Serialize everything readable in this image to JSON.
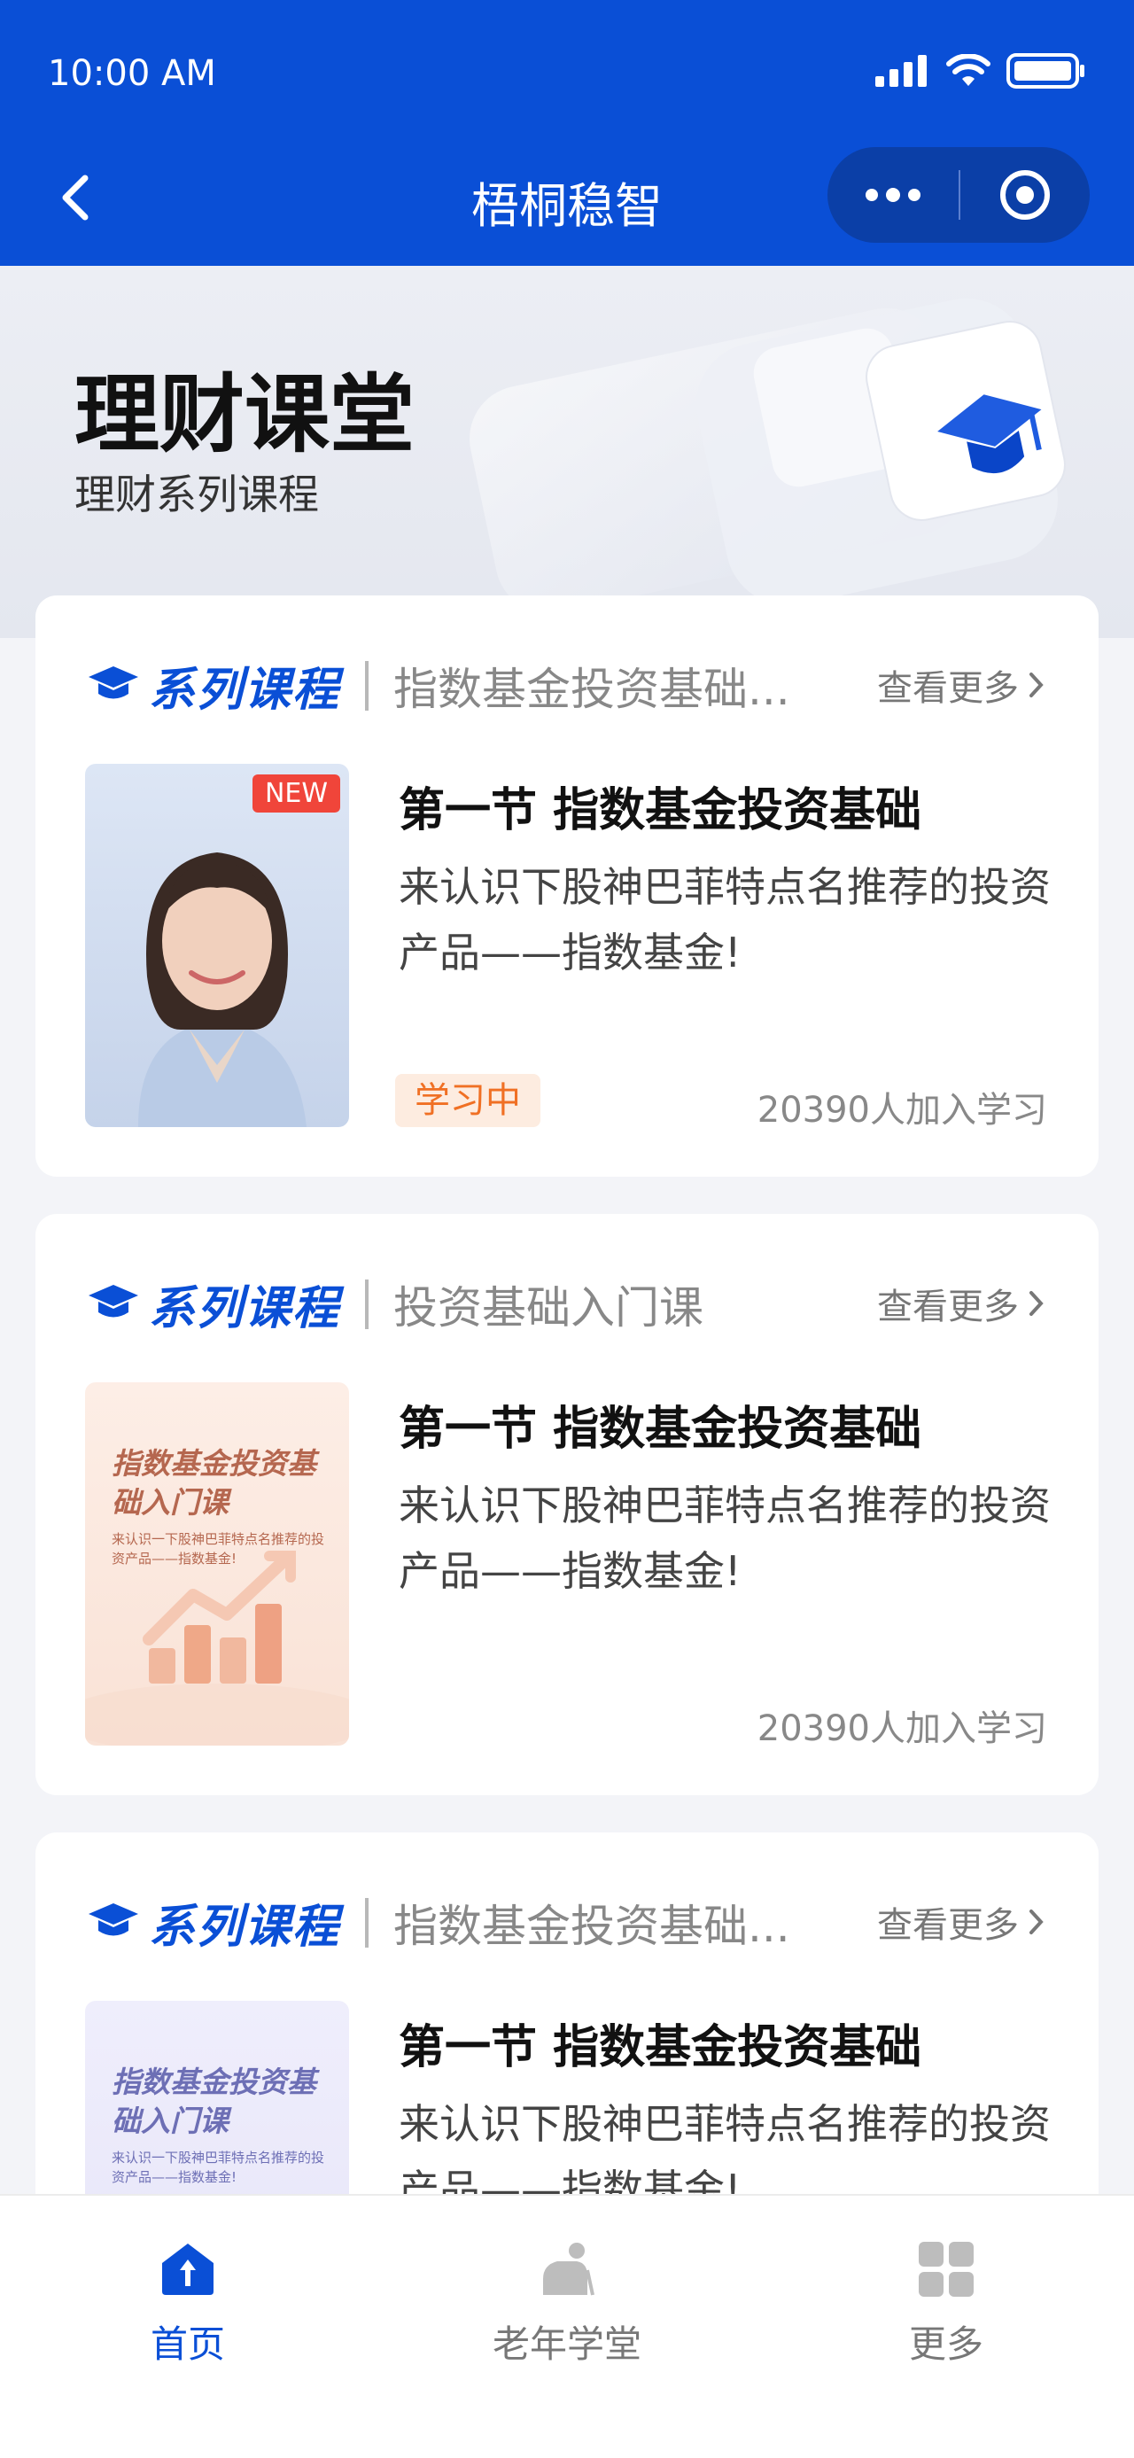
{
  "status_bar": {
    "time": "10:00 AM"
  },
  "nav": {
    "title": "梧桐稳智"
  },
  "banner": {
    "title": "理财课堂",
    "subtitle": "理财系列课程"
  },
  "colors": {
    "primary": "#0a4fd6",
    "tag_orange": "#f07024",
    "tag_bg": "#fdece0"
  },
  "cards": [
    {
      "series_label": "系列课程",
      "course_name": "指数基金投资基础...",
      "more_label": "查看更多",
      "thumb_badge": "NEW",
      "lesson_title": "第一节  指数基金投资基础",
      "lesson_desc": "来认识下股神巴菲特点名推荐的投资产品——指数基金!",
      "status_tag": "学习中",
      "learners": "20390人加入学习"
    },
    {
      "series_label": "系列课程",
      "course_name": "投资基础入门课",
      "more_label": "查看更多",
      "thumb_title": "指数基金投资基础入门课",
      "thumb_desc": "来认识一下股神巴菲特点名推荐的投资产品——指数基金!",
      "lesson_title": "第一节  指数基金投资基础",
      "lesson_desc": "来认识下股神巴菲特点名推荐的投资产品——指数基金!",
      "learners": "20390人加入学习"
    },
    {
      "series_label": "系列课程",
      "course_name": "指数基金投资基础...",
      "more_label": "查看更多",
      "thumb_title": "指数基金投资基础入门课",
      "thumb_desc": "来认识一下股神巴菲特点名推荐的投资产品——指数基金!",
      "lesson_title": "第一节  指数基金投资基础",
      "lesson_desc": "来认识下股神巴菲特点名推荐的投资产品——指数基金!"
    }
  ],
  "tabbar": {
    "items": [
      {
        "label": "首页",
        "icon": "home-icon",
        "active": true
      },
      {
        "label": "老年学堂",
        "icon": "elder-icon",
        "active": false
      },
      {
        "label": "更多",
        "icon": "grid-icon",
        "active": false
      }
    ]
  }
}
